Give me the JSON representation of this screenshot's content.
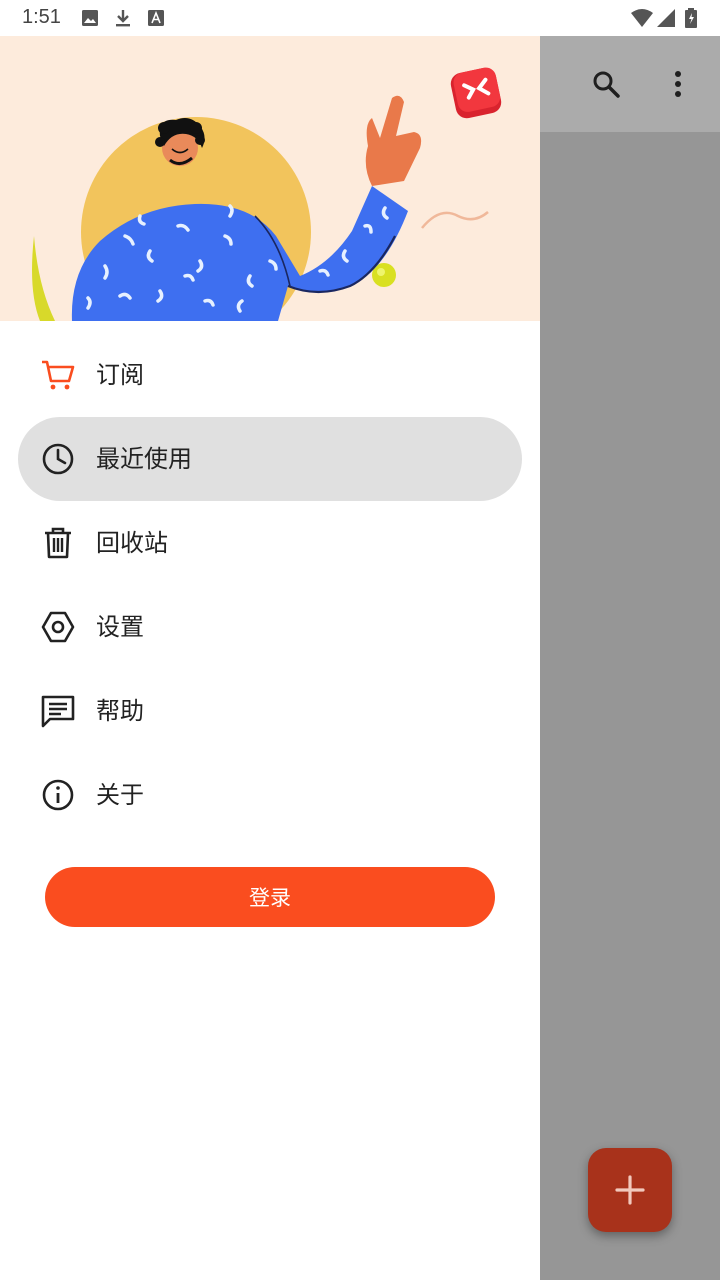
{
  "status_bar": {
    "time": "1:51",
    "icons": [
      "image-icon",
      "download-icon",
      "text-icon",
      "wifi-icon",
      "signal-icon",
      "battery-icon"
    ]
  },
  "app_toolbar": {
    "icons": [
      "search-icon",
      "more-vert-icon"
    ]
  },
  "drawer": {
    "menu": [
      {
        "label": "订阅",
        "icon": "cart-icon",
        "active": false
      },
      {
        "label": "最近使用",
        "icon": "clock-icon",
        "active": true
      },
      {
        "label": "回收站",
        "icon": "trash-icon",
        "active": false
      },
      {
        "label": "设置",
        "icon": "hexagon-settings-icon",
        "active": false
      },
      {
        "label": "帮助",
        "icon": "help-chat-icon",
        "active": false
      },
      {
        "label": "关于",
        "icon": "info-icon",
        "active": false
      }
    ],
    "login_label": "登录"
  },
  "fab": {
    "icon": "plus-icon"
  },
  "colors": {
    "accent": "#fa4d1f",
    "header_bg": "#fdebdc",
    "active_item_bg": "#e0e0e0",
    "scrim": "#969696",
    "fab": "#a8321b"
  }
}
